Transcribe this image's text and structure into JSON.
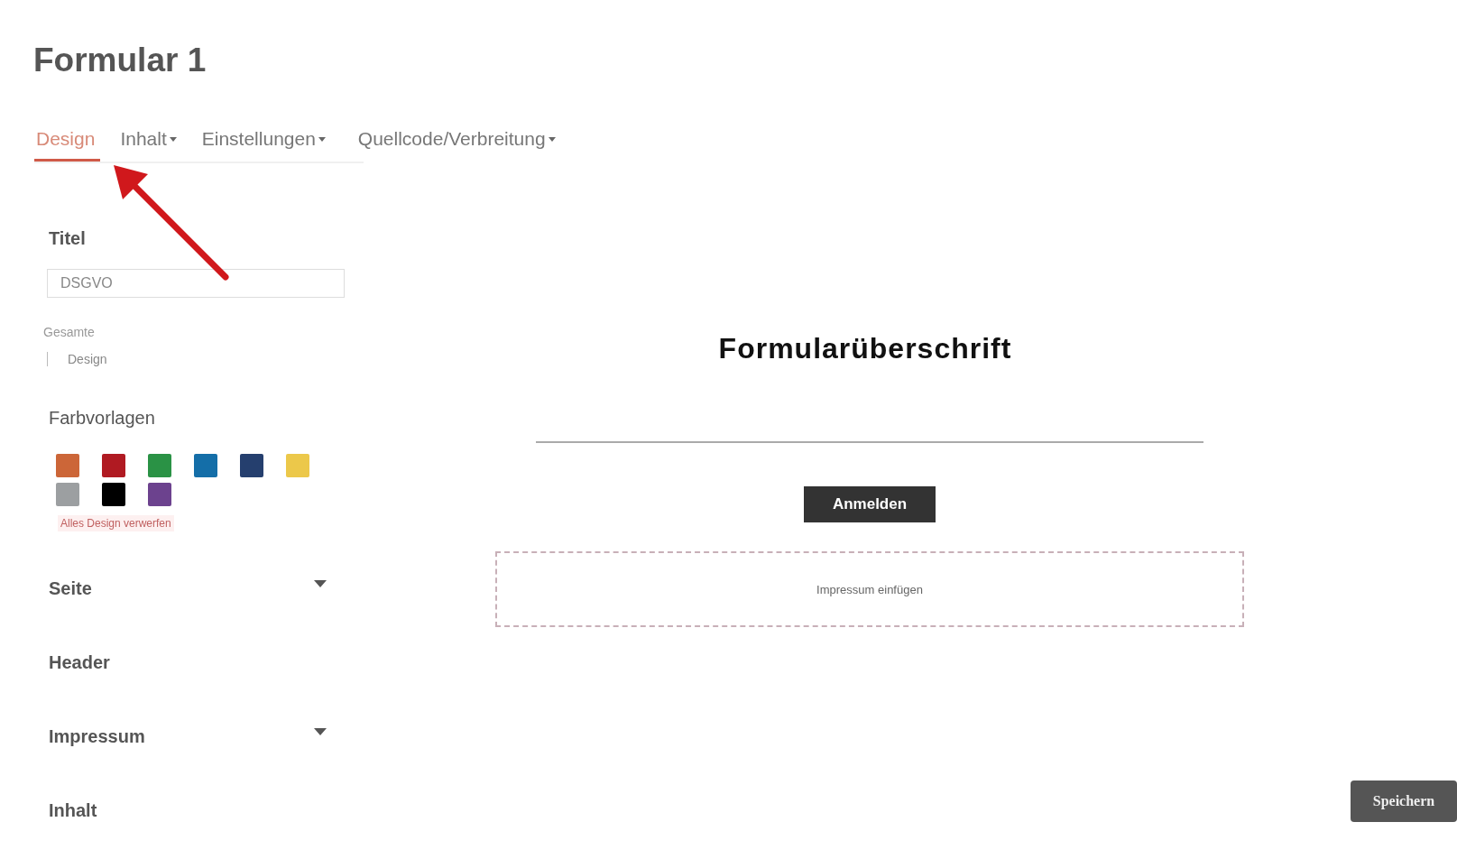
{
  "page_title": "Formular 1",
  "tabs": [
    {
      "label": "Design",
      "selected": true,
      "dropdown": false
    },
    {
      "label": "Inhalt",
      "selected": false,
      "dropdown": true
    },
    {
      "label": "Einstellungen",
      "selected": false,
      "dropdown": true
    },
    {
      "label": "Quellcode/Verbreitung",
      "selected": false,
      "dropdown": true
    }
  ],
  "sidebar": {
    "title_label": "Titel",
    "title_value": "DSGVO",
    "sub_label": "Gesamte",
    "sub_value": "Design",
    "colors_label": "Farbvorlagen",
    "swatches": [
      {
        "color": "#cc6638"
      },
      {
        "color": "#b01a22"
      },
      {
        "color": "#2a9245"
      },
      {
        "color": "#146ea8"
      },
      {
        "color": "#253f6e"
      },
      {
        "color": "#ecc84a"
      },
      {
        "color": "#9c9fa1"
      },
      {
        "color": "#000000"
      },
      {
        "color": "#6c428e"
      }
    ],
    "reset_link": "Alles Design verwerfen",
    "sections": [
      {
        "label": "Seite",
        "kind": "dropdown"
      },
      {
        "label": "Header",
        "kind": "plain"
      },
      {
        "label": "Impressum",
        "kind": "dropdown"
      },
      {
        "label": "Inhalt",
        "kind": "plain"
      }
    ]
  },
  "preview": {
    "heading": "Formularüberschrift",
    "button": "Anmelden",
    "footer_text": "Impressum einfügen"
  },
  "save_button": "Speichern"
}
